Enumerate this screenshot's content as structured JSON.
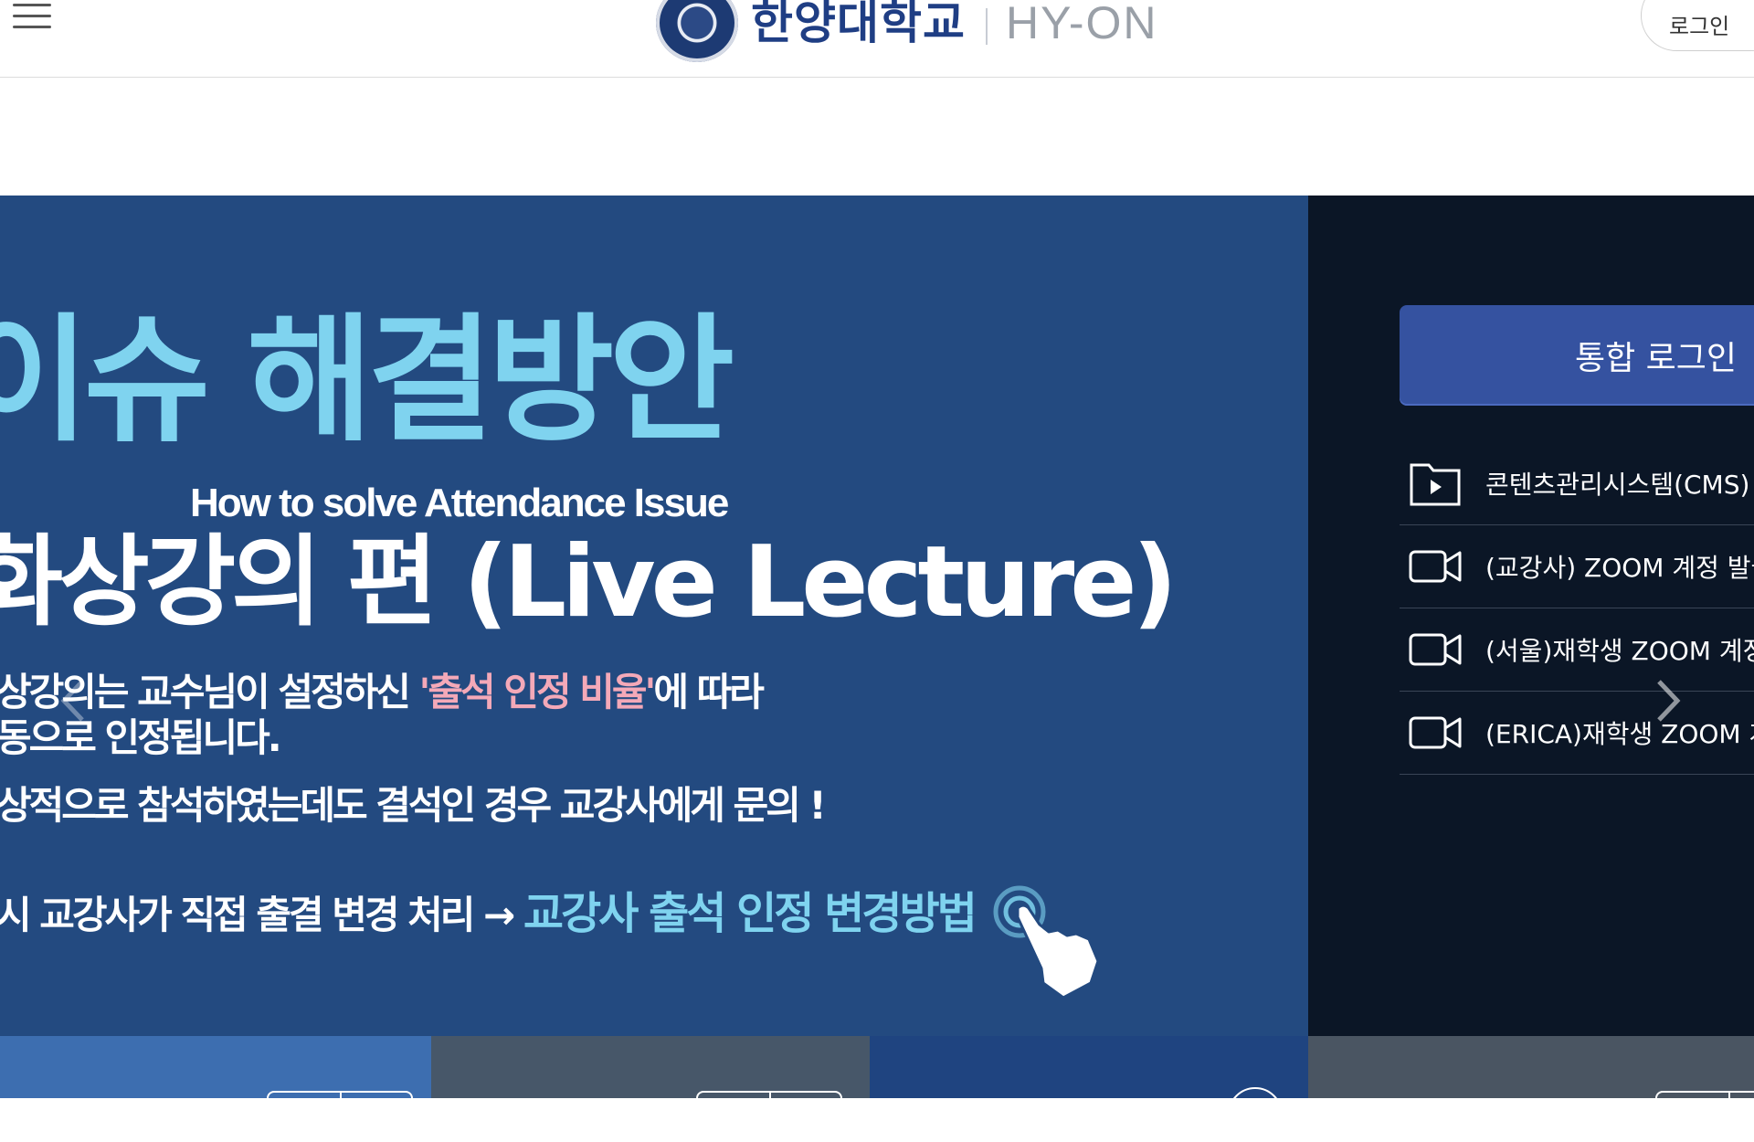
{
  "header": {
    "university_name": "한양대학교",
    "service_name": "HY-ON",
    "login_label": "로그인",
    "logo_icon": "university-seal",
    "menu_icon": "hamburger-menu-icon"
  },
  "hero": {
    "title_line1": "이슈 해결방안",
    "subtitle_en": "How to solve Attendance Issue",
    "title_line2": "화상강의 편 (Live Lecture)",
    "line3_before": "상강의는 교수님이 설정하신 ",
    "line3_highlight": "'출석 인정 비율'",
    "line3_after": "에 따라",
    "line4": "동으로 인정됩니다.",
    "line5": "상적으로 참석하였는데도 결석인 경우 교강사에게 문의 !",
    "line6_before": "시 교강사가 직접 출결 변경 처리 → ",
    "line6_link": "교강사 출석 인정 변경방법",
    "colors": {
      "background": "#234a80",
      "accent_cyan": "#7fd3ef",
      "accent_pink": "#f4a9b8"
    }
  },
  "right_panel": {
    "sso_label": "통합 로그인",
    "items": [
      {
        "label": "콘텐츠관리시스템(CMS)",
        "icon": "folder-play-icon"
      },
      {
        "label": "(교강사) ZOOM 계정 발급",
        "icon": "video-camera-icon"
      },
      {
        "label": "(서울)재학생 ZOOM 계정",
        "icon": "video-camera-icon"
      },
      {
        "label": "(ERICA)재학생 ZOOM 계",
        "icon": "video-camera-icon"
      }
    ],
    "colors": {
      "background": "#0b1626",
      "button": "#3552a0"
    }
  },
  "bottom_tiles": {
    "colors": [
      "#3d6eb0",
      "#475769",
      "#1f4480",
      "#4a5562"
    ]
  }
}
